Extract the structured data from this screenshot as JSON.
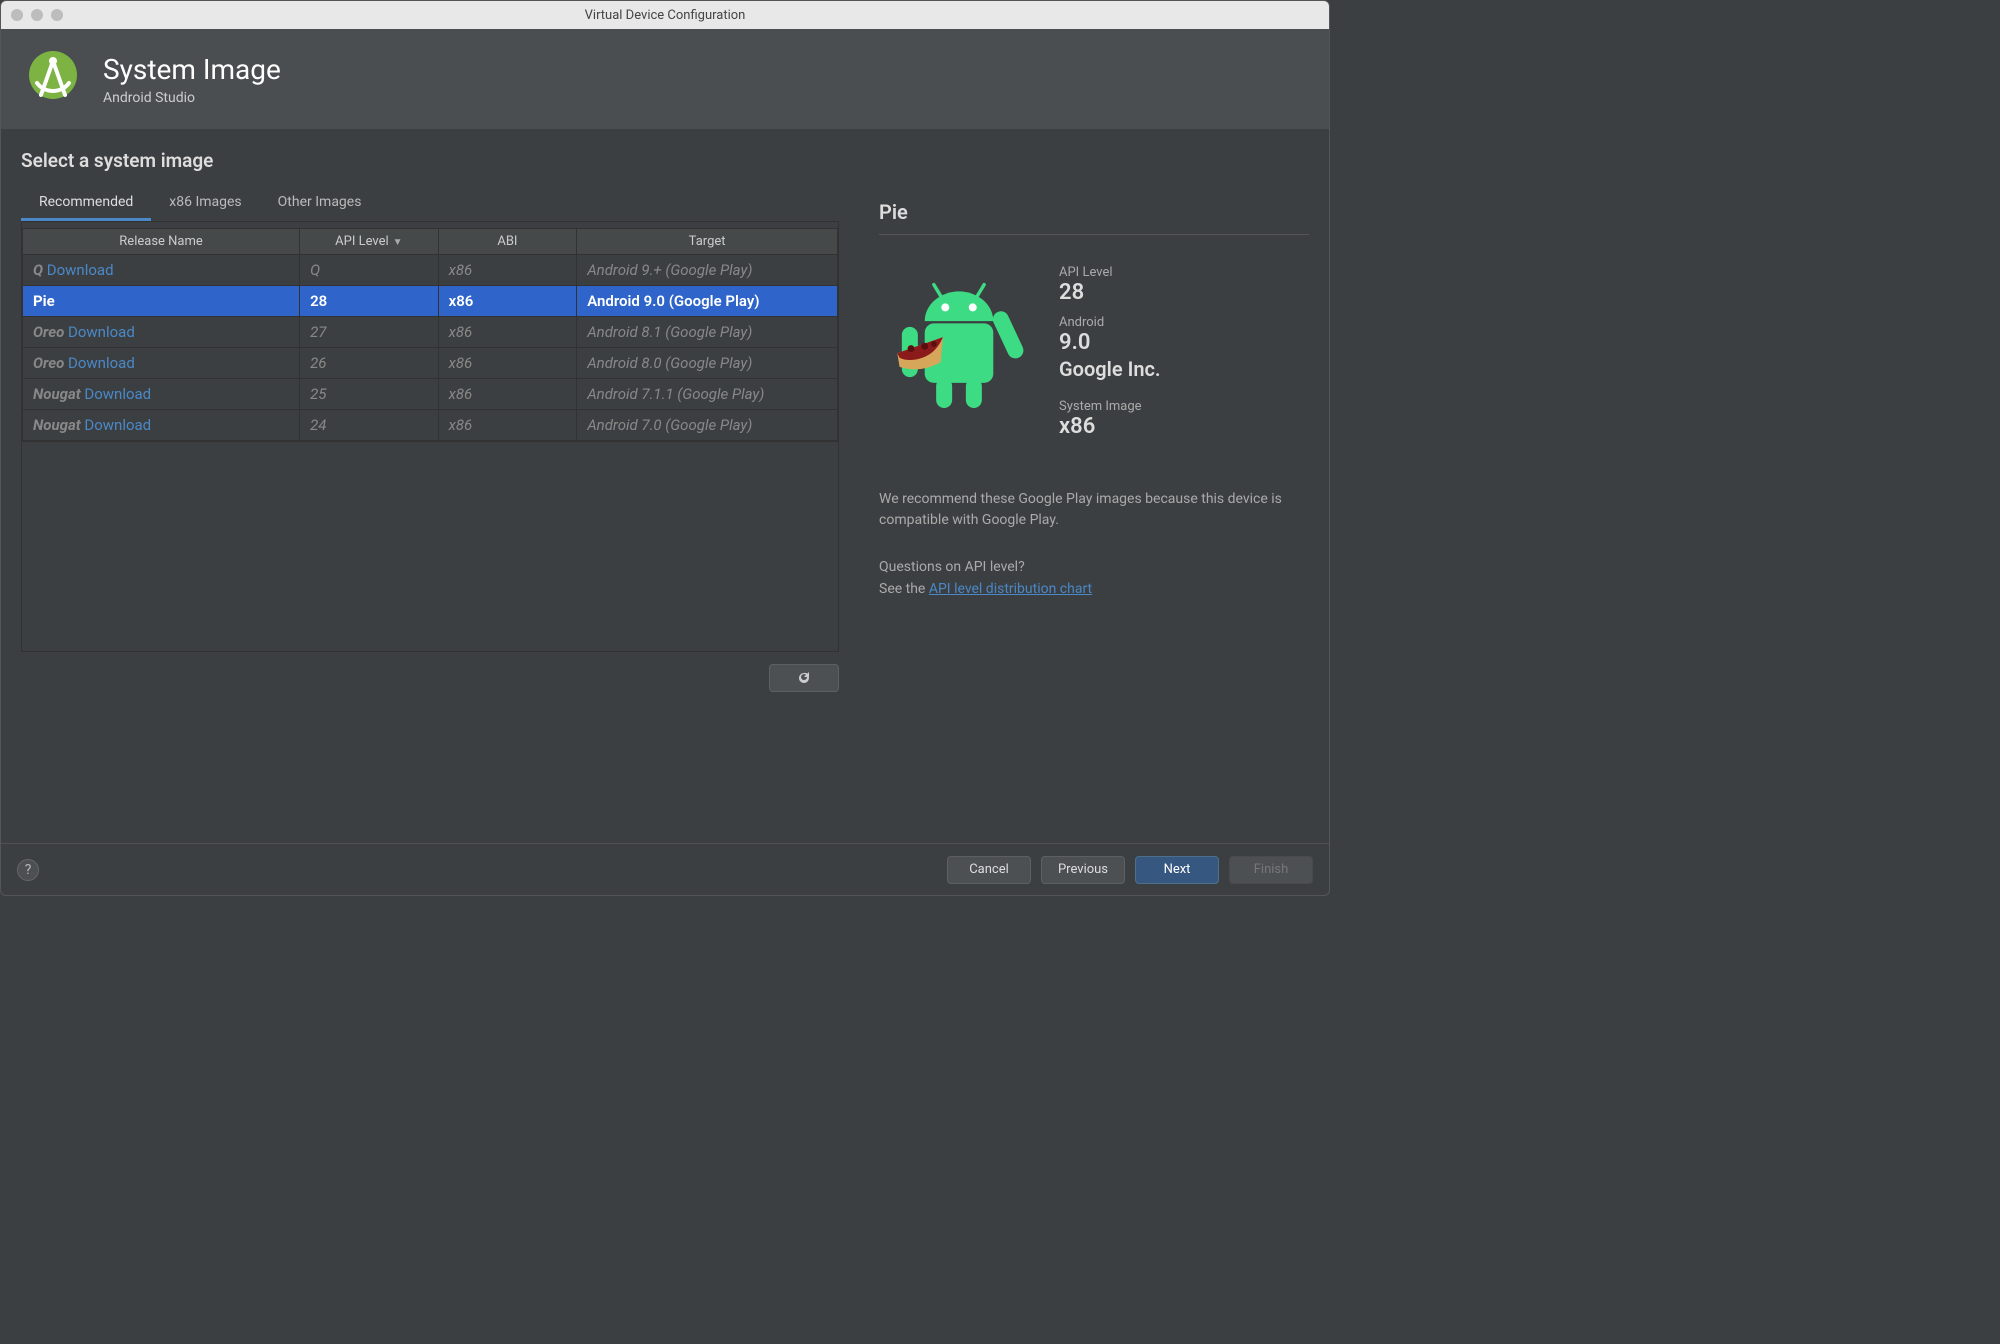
{
  "window": {
    "title": "Virtual Device Configuration"
  },
  "header": {
    "title": "System Image",
    "subtitle": "Android Studio"
  },
  "section": {
    "title": "Select a system image"
  },
  "tabs": [
    {
      "label": "Recommended",
      "active": true
    },
    {
      "label": "x86 Images",
      "active": false
    },
    {
      "label": "Other Images",
      "active": false
    }
  ],
  "columns": {
    "release": "Release Name",
    "api": "API Level",
    "abi": "ABI",
    "target": "Target"
  },
  "rows": [
    {
      "release": "Q",
      "download": "Download",
      "api": "Q",
      "abi": "x86",
      "target": "Android 9.+ (Google Play)",
      "selected": false,
      "has_download": true
    },
    {
      "release": "Pie",
      "download": "",
      "api": "28",
      "abi": "x86",
      "target": "Android 9.0 (Google Play)",
      "selected": true,
      "has_download": false
    },
    {
      "release": "Oreo",
      "download": "Download",
      "api": "27",
      "abi": "x86",
      "target": "Android 8.1 (Google Play)",
      "selected": false,
      "has_download": true
    },
    {
      "release": "Oreo",
      "download": "Download",
      "api": "26",
      "abi": "x86",
      "target": "Android 8.0 (Google Play)",
      "selected": false,
      "has_download": true
    },
    {
      "release": "Nougat",
      "download": "Download",
      "api": "25",
      "abi": "x86",
      "target": "Android 7.1.1 (Google Play)",
      "selected": false,
      "has_download": true
    },
    {
      "release": "Nougat",
      "download": "Download",
      "api": "24",
      "abi": "x86",
      "target": "Android 7.0 (Google Play)",
      "selected": false,
      "has_download": true
    }
  ],
  "details": {
    "name": "Pie",
    "api_label": "API Level",
    "api_value": "28",
    "android_label": "Android",
    "android_value": "9.0",
    "vendor": "Google Inc.",
    "sysimg_label": "System Image",
    "sysimg_value": "x86",
    "recommend": "We recommend these Google Play images because this device is compatible with Google Play.",
    "question": "Questions on API level?",
    "see_prefix": "See the ",
    "see_link": "API level distribution chart"
  },
  "footer": {
    "cancel": "Cancel",
    "previous": "Previous",
    "next": "Next",
    "finish": "Finish"
  }
}
